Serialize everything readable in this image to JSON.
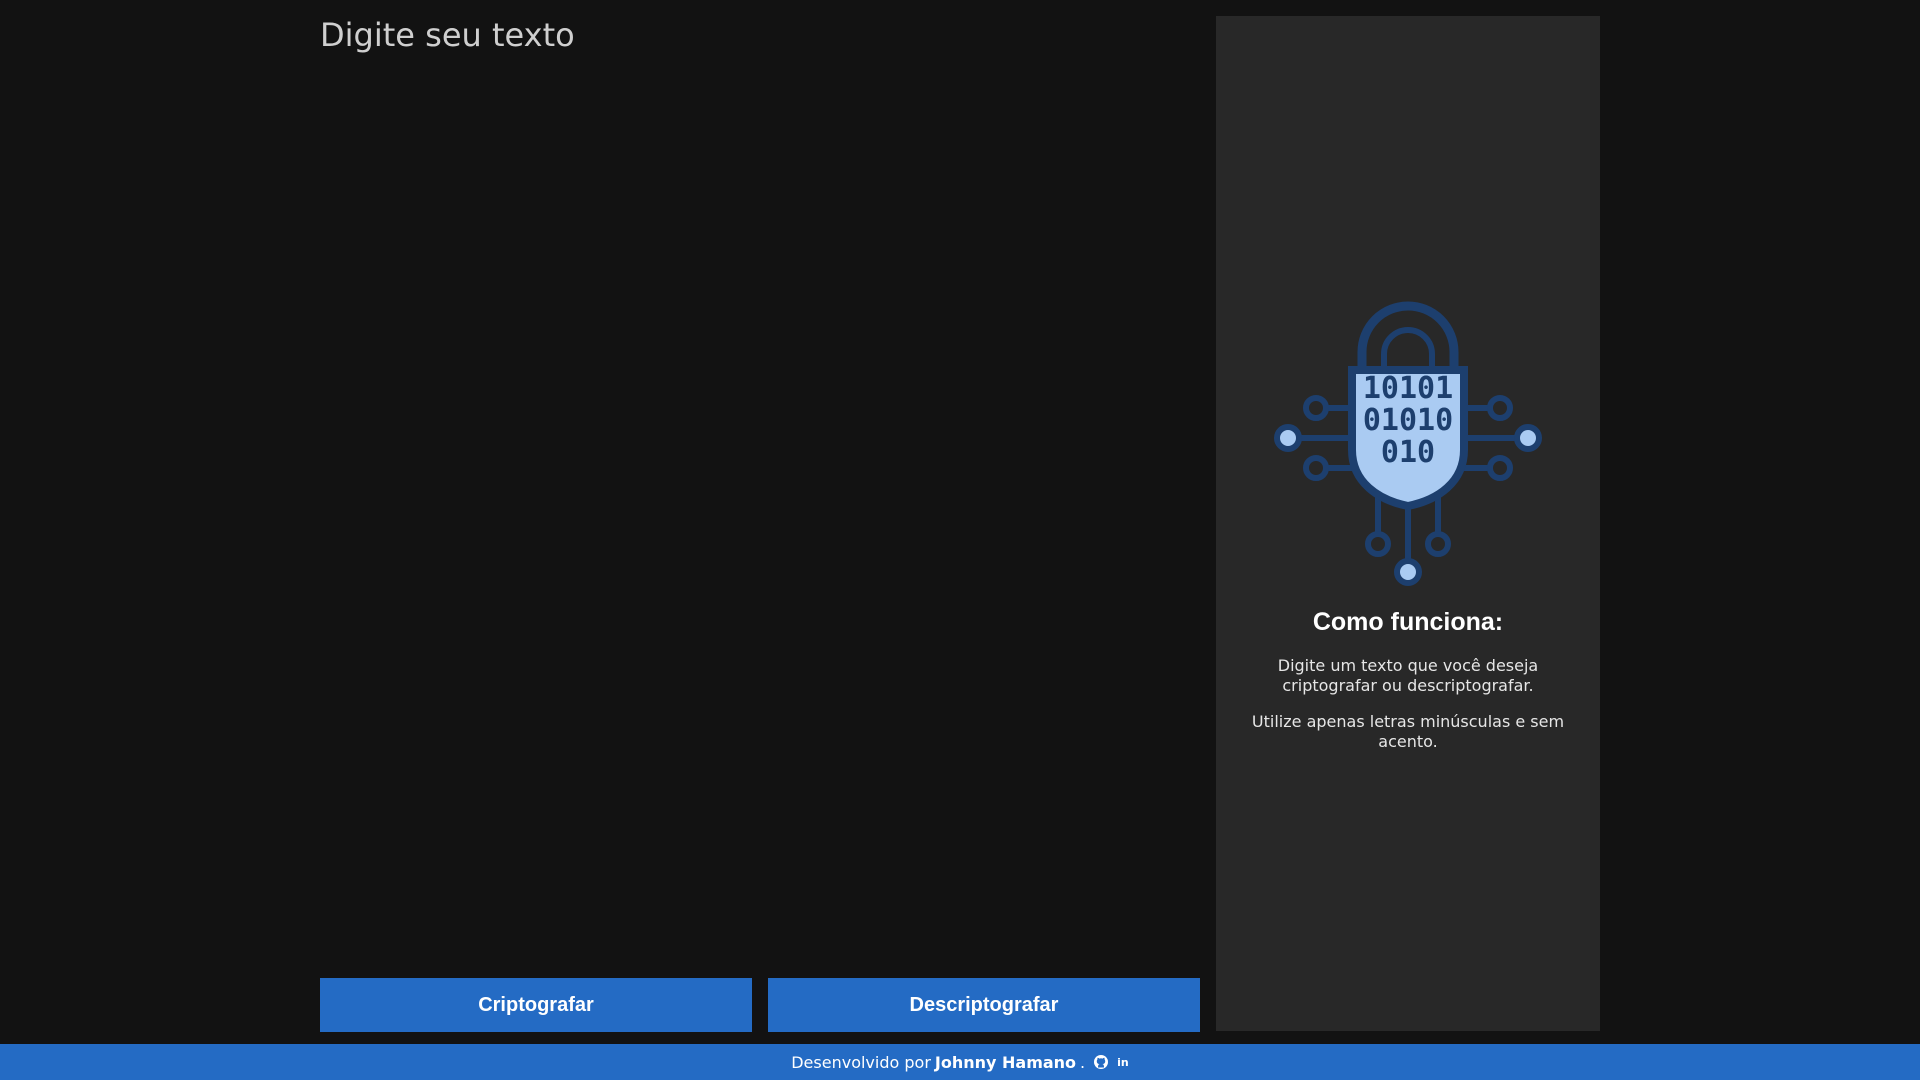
{
  "input": {
    "placeholder": "Digite seu texto",
    "value": ""
  },
  "buttons": {
    "encrypt_label": "Criptografar",
    "decrypt_label": "Descriptografar"
  },
  "side_panel": {
    "illustration_icon": "binary-lock-icon",
    "illustration_digits": [
      "10101",
      "01010",
      "010"
    ],
    "title": "Como funciona:",
    "paragraph_1": "Digite um texto que você deseja criptografar ou descriptografar.",
    "paragraph_2": "Utilize apenas letras minúsculas e sem acento."
  },
  "footer": {
    "prefix": "Desenvolvido por",
    "author": "Johnny Hamano",
    "suffix": ".",
    "github_icon": "github-icon",
    "linkedin_icon": "linkedin-icon",
    "linkedin_text": "in"
  },
  "colors": {
    "background": "#121212",
    "panel": "#282828",
    "accent": "#246bc4",
    "illustration_dark": "#1d3f6e",
    "illustration_light": "#aacbf2"
  }
}
